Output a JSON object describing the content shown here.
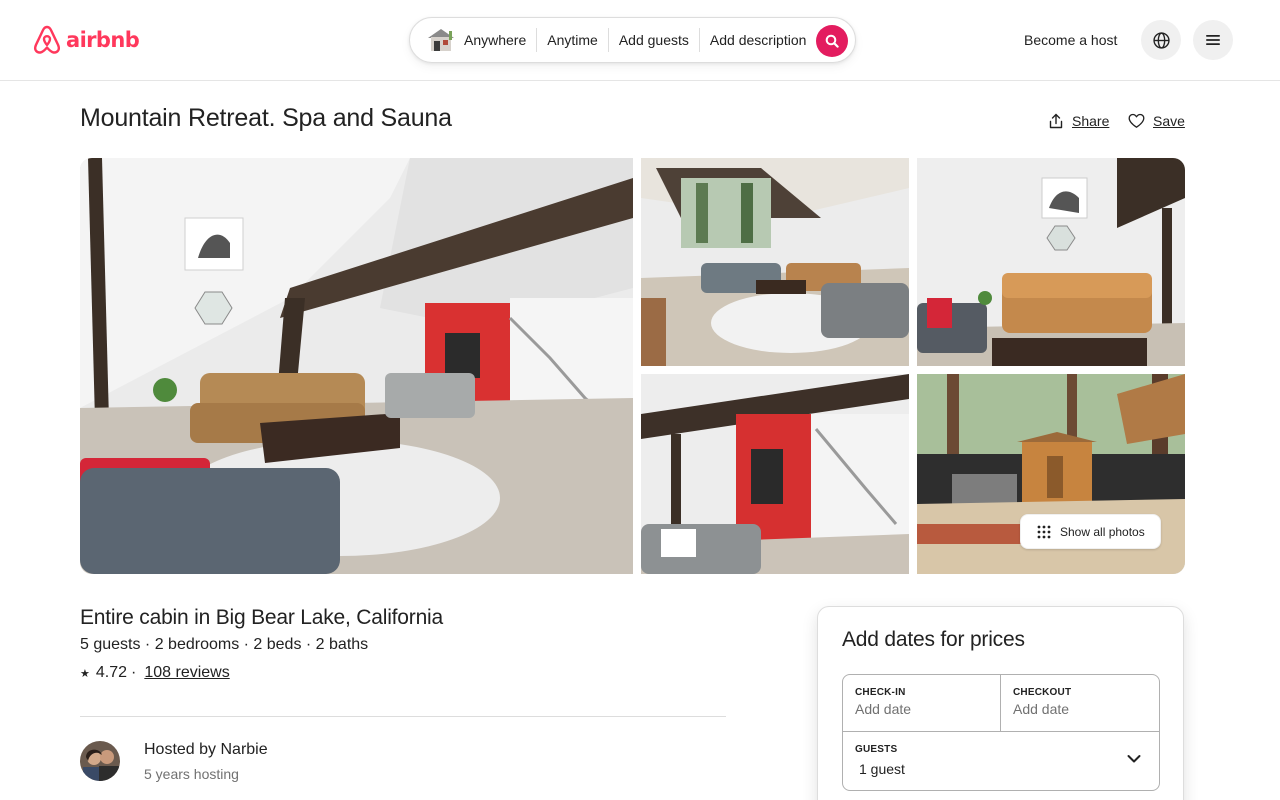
{
  "header": {
    "logo_text": "airbnb",
    "brand_color": "#ff385c",
    "search": {
      "anywhere": "Anywhere",
      "anytime": "Anytime",
      "add_guests": "Add guests",
      "add_description": "Add description",
      "button_color": "#e31c5f"
    },
    "become_host": "Become a host",
    "globe_icon": "globe-icon",
    "menu_icon": "hamburger-menu-icon"
  },
  "listing": {
    "title": "Mountain Retreat. Spa and Sauna",
    "share_label": "Share",
    "save_label": "Save",
    "show_all_photos": "Show all photos",
    "type": "Entire cabin in Big Bear Lake, California",
    "details": "5 guests · 2 bedrooms · 2 beds · 2 baths",
    "rating": "4.72",
    "reviews": "108 reviews",
    "host": {
      "hosted_by": "Hosted by Narbie",
      "years": "5 years hosting"
    }
  },
  "booking": {
    "title": "Add dates for prices",
    "checkin_label": "CHECK-IN",
    "checkin_value": "Add date",
    "checkout_label": "CHECKOUT",
    "checkout_value": "Add date",
    "guests_label": "GUESTS",
    "guests_value": "1 guest"
  }
}
